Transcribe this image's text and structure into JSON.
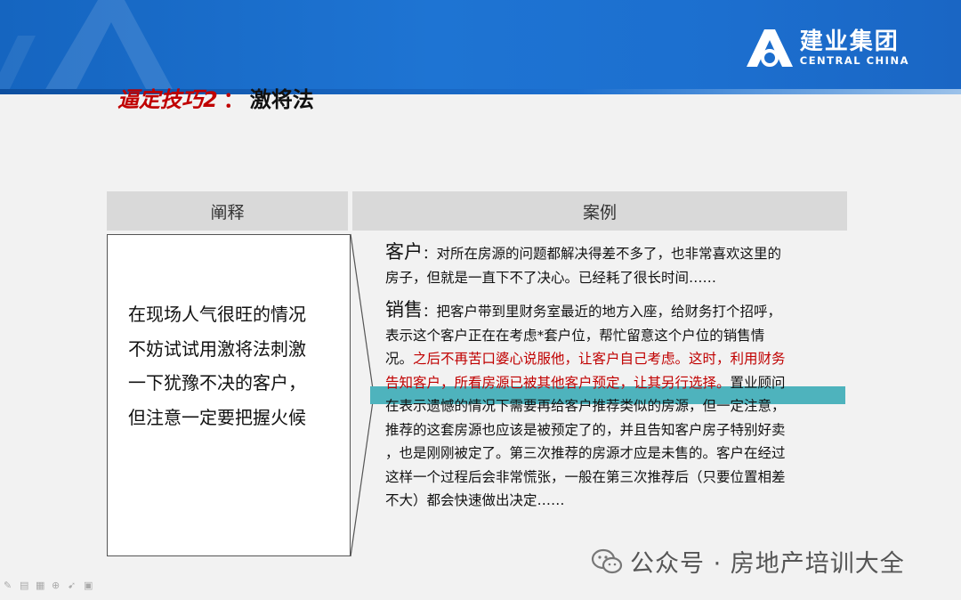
{
  "brand": {
    "name_cn": "建业集团",
    "name_en": "CENTRAL CHINA"
  },
  "title": {
    "part1": "逼定技巧2",
    "separator": "：",
    "part2": "激将法"
  },
  "table": {
    "headers": {
      "left": "阐释",
      "right": "案例"
    },
    "explanation_lines": [
      "在现场人气很旺的情况",
      "不妨试试用激将法刺激",
      "一下犹豫不决的客户，",
      "但注意一定要把握火候"
    ],
    "case": {
      "customer_label": "客户",
      "customer_line1": "：对所在房源的问题都解决得差不多了，也非常喜欢这里的",
      "customer_line2": "房子，但就是一直下不了决心。已经耗了很长时间……",
      "sales_label": "销售",
      "sales_line1": "：把客户带到里财务室最近的地方入座，给财务打个招呼，",
      "sales_line2": "表示这个客户正在在考虑*套户位，帮忙留意这个户位的销售情",
      "sales_line3_plain": "况。",
      "sales_line3_red": "之后不再苦口婆心说服他，让客户自己考虑。这时，利用财务",
      "sales_line4_red": "告知客户，所看房源已被其他客户预定，让其另行选择。",
      "sales_line4_plain": "置业顾问",
      "sales_line5": "在表示遗憾的情况下需要再给客户推荐类似的房源，但一定注意，",
      "sales_line6": "推荐的这套房源也应该是被预定了的，并且告知客户房子特别好卖",
      "sales_line7": "，也是刚刚被定了。第三次推荐的房源才应是未售的。客户在经过",
      "sales_line8": "这样一个过程后会非常慌张，一般在第三次推荐后（只要位置相差",
      "sales_line9": "不大）都会快速做出决定……"
    }
  },
  "watermark": {
    "text": "公众号 · 房地产培训大全",
    "icon": "wechat-icon"
  },
  "colors": {
    "accent_red": "#c00000",
    "header_blue": "#1c6fcf",
    "highlight_teal": "#4eb3bd"
  }
}
